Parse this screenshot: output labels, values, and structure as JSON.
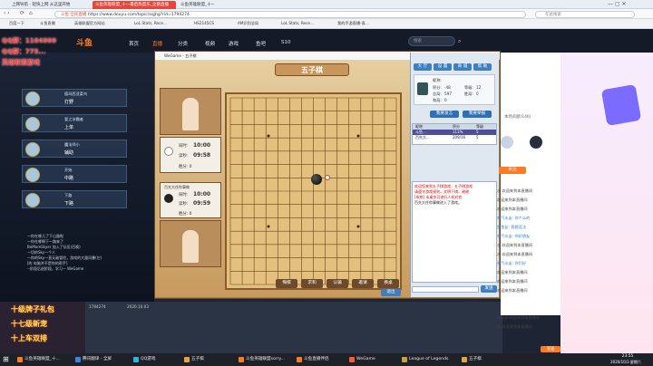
{
  "browser": {
    "tabs": [
      "上网导航 - 轻快上网 从这里开始",
      "斗鱼英雄联盟_十一最后热度乐_企鹅直播",
      "斗鱼英雄联盟_十一最后热度乐_企鹅..."
    ],
    "url": "https://www.douyu.com/topic/xqjhg?rid=1794274",
    "url_prefix": "斗鱼 全民直播",
    "right_search": "在此搜索",
    "bookmarks": [
      "百度一下",
      "斗鱼直播",
      "英雄联盟官方网站",
      "LoL Stats, Rece...",
      "HS2145CS",
      "AM识别全局",
      "LoL Stats, Rece...",
      "我的手游直播-直..."
    ]
  },
  "site": {
    "logo": "斗鱼",
    "nav": [
      "首页",
      "直播",
      "分类",
      "视频",
      "游戏",
      "鱼吧",
      "S10"
    ],
    "search_placeholder": "搜索",
    "right_badge": "PC客户端"
  },
  "overlay_text": [
    "QQ群：1104000",
    "QQ群：775...",
    "英雄联盟游戏"
  ],
  "players": [
    {
      "name": "德玛西亚菜鸟",
      "rank": "打野"
    },
    {
      "name": "爱之冰霜者",
      "rank": "上单"
    },
    {
      "name": "魔法师小",
      "rank": "辅助"
    },
    {
      "name": "开始",
      "rank": "中路"
    },
    {
      "name": "下路",
      "rank": "下路"
    }
  ],
  "left_chat": [
    "一你在哪儿了下山路啦",
    "一你在哪啊下一路来了",
    "BeMoreSkyer 加入了队伍(召唤)",
    "一切的Sky一个人",
    "一你的Sky一直无敌冒险，游戏的大量风暴(它)",
    "[的 电脑并不是你的帮手]",
    "--阶段后退阶段，学习一 WeGame"
  ],
  "promo": [
    "十级牌子礼包",
    "十七级新宠",
    "十上车双排"
  ],
  "stream_info": {
    "viewers": "1784274",
    "time": "2020.10.03"
  },
  "game_window": {
    "title": "WeGame - 五子棋",
    "banner": "五子棋",
    "top_player": {
      "turn_label": "局时:",
      "total": "10:00",
      "move_label": "读秒:",
      "move": "09:58",
      "score": "胜分: 0"
    },
    "bottom_player": {
      "name": "百先大任你事做",
      "turn_label": "局时:",
      "total": "10:00",
      "move_label": "读秒:",
      "move": "09:59",
      "score": "胜分: 0"
    },
    "controls": [
      "悔棋",
      "求和",
      "认输",
      "邀请",
      "换桌"
    ],
    "exit": "退出",
    "panel_buttons": [
      "大 厅",
      "设 置",
      "商 城",
      "帮 助"
    ],
    "profile": {
      "name_label": "昵称:",
      "name": "",
      "score_label": "积分:",
      "score": "-48",
      "level_label": "等级:",
      "level": "12",
      "wins_label": "胜局:",
      "wins": "0",
      "draw_label": "和局:",
      "draw": "0",
      "games_label": "总局:",
      "games": "597"
    },
    "action_buttons": [
      "我要发言",
      "我要举报"
    ],
    "list_header": [
      "昵称",
      "积分",
      "等级"
    ],
    "list_rows": [
      [
        "斗鱼...",
        "111%",
        "5"
      ],
      [
        "百先大...",
        "209/16",
        "5"
      ]
    ],
    "chat_log": [
      "欢迎您来到五子棋游戏，五子棋游戏",
      "请遵守游戏规则，文明下棋，谢谢",
      "[系统] 本桌仅可进行人机对弈",
      "",
      "百先大任你事做进入了游戏。"
    ],
    "send_label": "发送"
  },
  "stream_chat": {
    "tab_label": "本场贡献(146)",
    "follow": "关注",
    "messages": [
      "水 欢迎来到本直播间",
      "欢迎来到本直播间",
      "欢迎来到本直播间",
      "帅气水友: 你个么的",
      "是鱼友: 我都没法",
      "帅气水友: 你好朋友",
      "水 欢迎来到本直播间",
      "水 欢迎来到本直播间",
      "帅气水友: 你们好",
      "欢迎来到本直播间",
      "欢迎来到本直播间",
      "欢迎来到本直播间",
      "Saizai 欢迎来到本直播间",
      "水 欢迎来到本直播间"
    ],
    "send_button": "发送"
  },
  "taskbar": {
    "items": [
      "斗鱼英雄联盟_十...",
      "腾讯翻译 - 全屏",
      "QQ游戏",
      "五子棋",
      "斗鱼英雄联盟sorry...",
      "斗鱼直播伴侣",
      "WeGame",
      "League of Legends",
      "五子棋"
    ],
    "clock": "23:55",
    "date": "2020/10/3 星期六"
  },
  "colors": {
    "accent": "#e8463b",
    "board": "#e3c07e",
    "panel": "#dfe7f0"
  }
}
